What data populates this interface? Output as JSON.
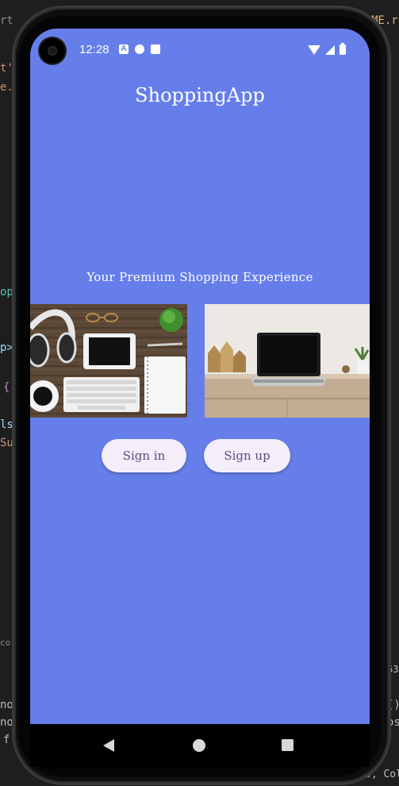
{
  "background": {
    "left_fragments": [
      "rt",
      "t'",
      "e.",
      "op",
      "p>",
      "{",
      "ls",
      "Su",
      "co",
      "no",
      "no",
      "f"
    ],
    "right_fragments": [
      "ME.r",
      "63",
      "()",
      "os",
      "9, Col"
    ]
  },
  "status_bar": {
    "time": "12:28",
    "icons_left": [
      "a-notification-icon",
      "p-notification-icon",
      "sd-card-icon"
    ],
    "icons_right": [
      "wifi-icon",
      "signal-icon",
      "battery-icon"
    ]
  },
  "app": {
    "title": "ShoppingApp",
    "tagline": "Your Premium Shopping Experience",
    "images": [
      {
        "name": "desk-accessories-image",
        "description_icon": "headphones-tablet-keyboard-notebook"
      },
      {
        "name": "laptop-desk-image",
        "description_icon": "laptop-on-wooden-desk"
      }
    ],
    "buttons": {
      "sign_in": "Sign in",
      "sign_up": "Sign up"
    },
    "colors": {
      "background": "#667eea",
      "button_bg": "#f3eefa",
      "button_text": "#5b4b87"
    }
  },
  "nav_bar": {
    "items": [
      "back-icon",
      "home-icon",
      "recents-icon"
    ]
  }
}
